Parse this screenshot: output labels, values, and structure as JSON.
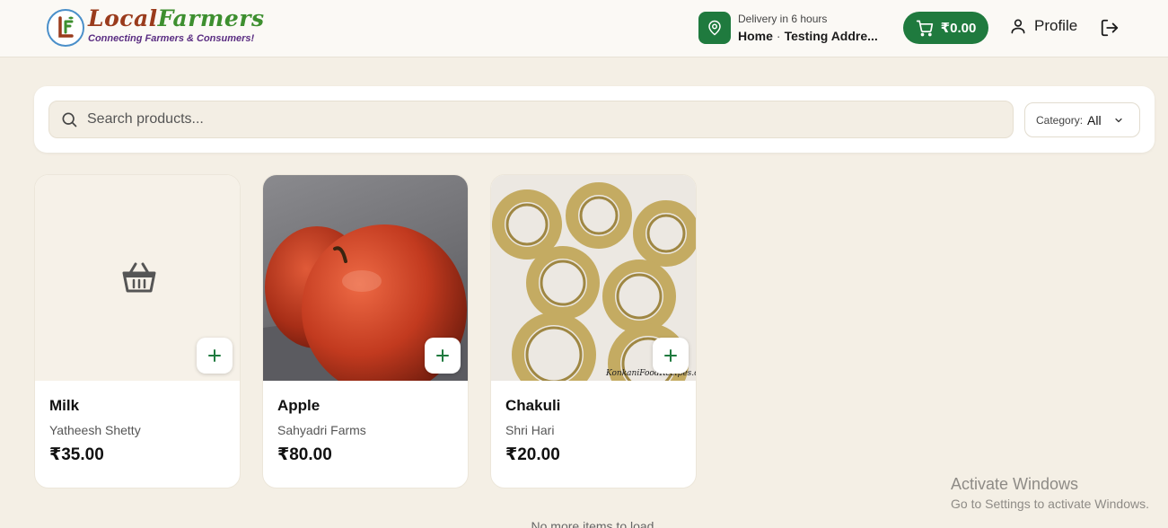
{
  "header": {
    "logo_title_part1": "Local",
    "logo_title_part2": "Farmers",
    "logo_tagline": "Connecting Farmers & Consumers!",
    "delivery_eta": "Delivery in 6 hours",
    "delivery_label": "Home",
    "delivery_address": "Testing Addre...",
    "cart_total": "₹0.00",
    "profile_label": "Profile"
  },
  "search": {
    "placeholder": "Search products...",
    "value": "",
    "category_label": "Category:",
    "category_value": "All"
  },
  "products": [
    {
      "name": "Milk",
      "farmer": "Yatheesh Shetty",
      "price": "₹35.00",
      "image": "basket-icon"
    },
    {
      "name": "Apple",
      "farmer": "Sahyadri Farms",
      "price": "₹80.00",
      "image": "apple-photo"
    },
    {
      "name": "Chakuli",
      "farmer": "Shri Hari",
      "price": "₹20.00",
      "image": "chakuli-photo",
      "image_watermark": "KonkaniFoodRecipes.com"
    }
  ],
  "footer": {
    "no_more_items": "No more items to load"
  },
  "windows_watermark": {
    "title": "Activate Windows",
    "subtitle": "Go to Settings to activate Windows."
  },
  "colors": {
    "brand_green": "#1f7a3e",
    "page_bg": "#f4efe5"
  }
}
